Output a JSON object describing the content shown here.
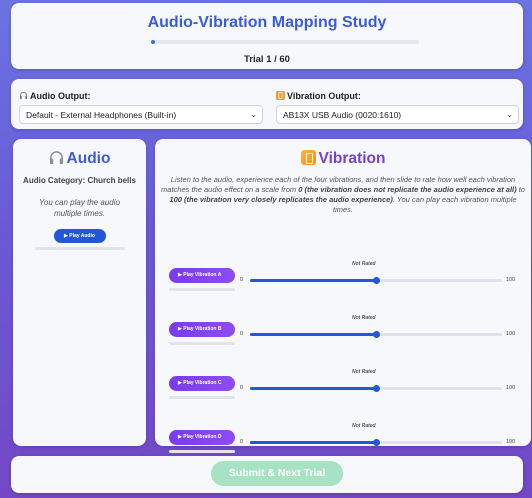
{
  "header": {
    "title": "Audio-Vibration Mapping Study",
    "trial_label": "Trial 1 / 60",
    "progress_fraction": 0.0167
  },
  "devices": {
    "audio_label": "Audio Output:",
    "audio_selected": "Default - External Headphones (Built-in)",
    "vibration_label": "Vibration Output:",
    "vibration_selected": "AB13X USB Audio (0020:1610)"
  },
  "audio": {
    "title": "Audio",
    "category": "Audio Category: Church bells",
    "note": "You can play the audio multiple times.",
    "play_label": "▶ Play Audio"
  },
  "vibration": {
    "title": "Vibration",
    "instructions_1": "Listen to the audio, experience each of the four vibrations, and then slide to rate how well each vibration matches the audio effect on a scale from ",
    "instructions_low": "0 (the vibration does not replicate the audio experience at all)",
    "instructions_2": " to ",
    "instructions_high": "100 (the vibration very closely replicates the audio experience)",
    "instructions_3": ". You can play each vibration multiple times.",
    "rows": [
      {
        "button": "▶ Play Vibration A",
        "status": "Not Rated",
        "min": "0",
        "max": "100",
        "value": 50
      },
      {
        "button": "▶ Play Vibration B",
        "status": "Not Rated",
        "min": "0",
        "max": "100",
        "value": 50
      },
      {
        "button": "▶ Play Vibration C",
        "status": "Not Rated",
        "min": "0",
        "max": "100",
        "value": 50
      },
      {
        "button": "▶ Play Vibration D",
        "status": "Not Rated",
        "min": "0",
        "max": "100",
        "value": 50
      }
    ]
  },
  "submit": {
    "label": "Submit & Next Trial"
  },
  "colors": {
    "accent_blue": "#2456d8",
    "accent_purple": "#7340d8",
    "submit_disabled": "#a6e2c3"
  }
}
